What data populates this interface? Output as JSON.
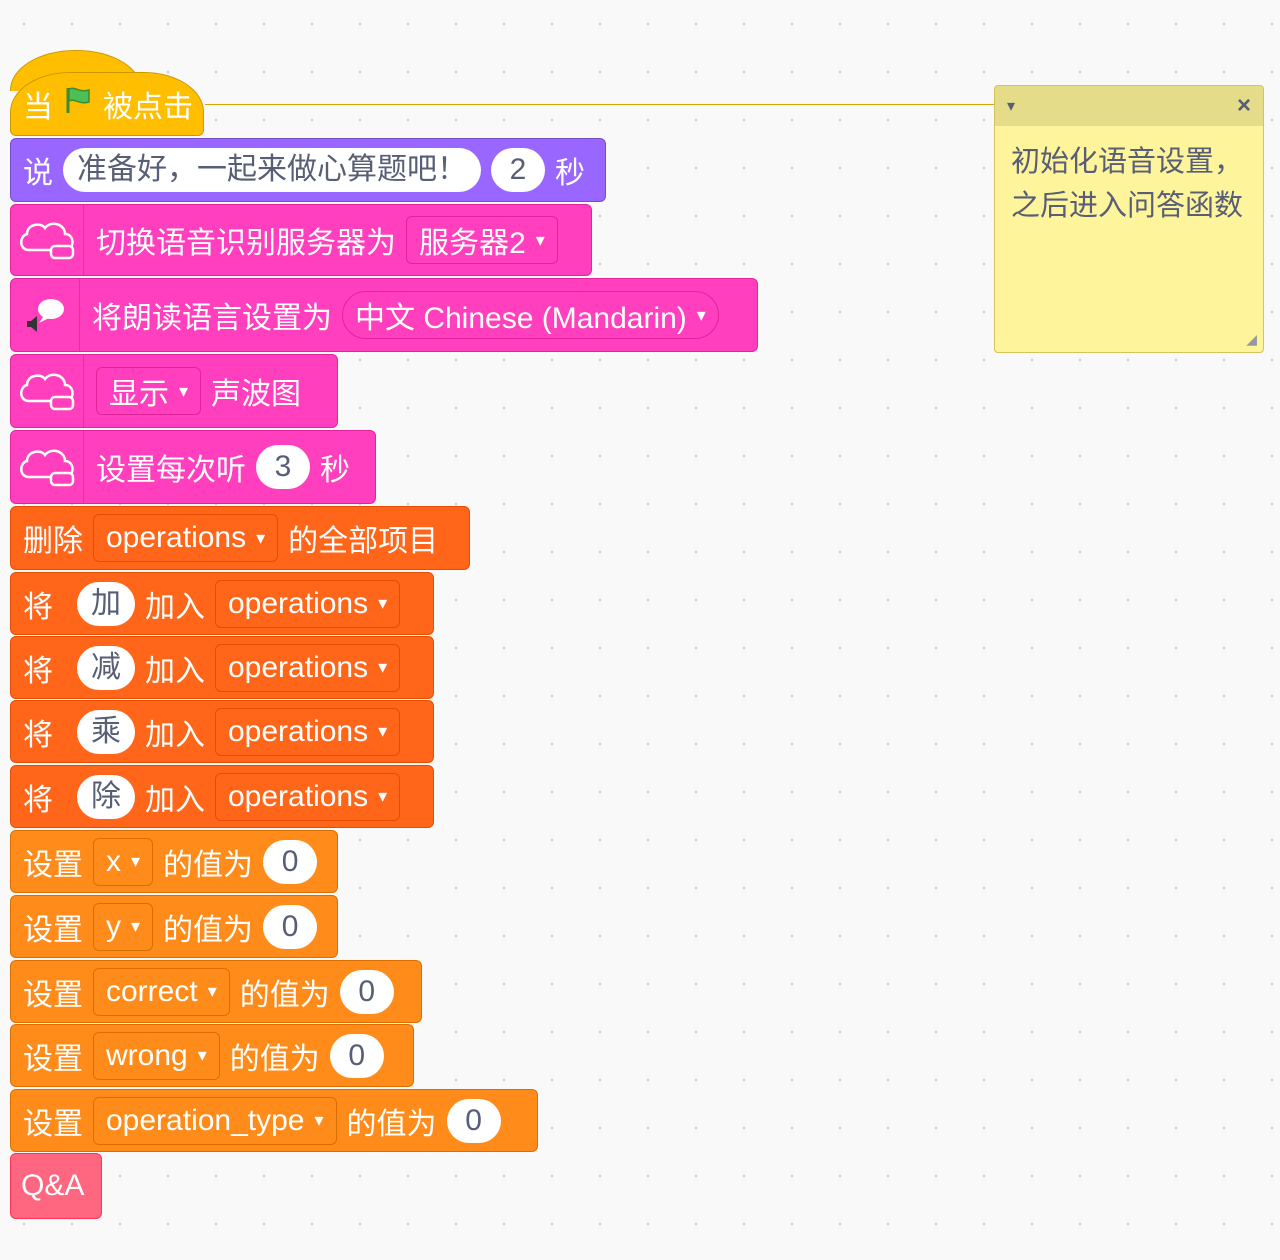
{
  "hat": {
    "when": "当",
    "clicked": "被点击",
    "flag_icon": "green-flag-icon",
    "color": "#ffbf00"
  },
  "say": {
    "label": "说",
    "message": "准备好，一起来做心算题吧！",
    "seconds": "2",
    "unit": "秒",
    "color": "#9966ff"
  },
  "speech_server": {
    "label": "切换语音识别服务器为",
    "server": "服务器2"
  },
  "tts_language": {
    "label": "将朗读语言设置为",
    "language": "中文 Chinese (Mandarin)"
  },
  "show_wave": {
    "mode": "显示",
    "label": "声波图"
  },
  "listen_time": {
    "label": "设置每次听",
    "seconds": "3",
    "unit": "秒"
  },
  "delete_all": {
    "label": "删除",
    "list": "operations",
    "suffix": "的全部项目"
  },
  "add_items": [
    {
      "prefix": "将",
      "item": "加",
      "mid": "加入",
      "list": "operations"
    },
    {
      "prefix": "将",
      "item": "减",
      "mid": "加入",
      "list": "operations"
    },
    {
      "prefix": "将",
      "item": "乘",
      "mid": "加入",
      "list": "operations"
    },
    {
      "prefix": "将",
      "item": "除",
      "mid": "加入",
      "list": "operations"
    }
  ],
  "set_vars": [
    {
      "prefix": "设置",
      "var": "x",
      "suffix": "的值为",
      "value": "0"
    },
    {
      "prefix": "设置",
      "var": "y",
      "suffix": "的值为",
      "value": "0"
    },
    {
      "prefix": "设置",
      "var": "correct",
      "suffix": "的值为",
      "value": "0"
    },
    {
      "prefix": "设置",
      "var": "wrong",
      "suffix": "的值为",
      "value": "0"
    },
    {
      "prefix": "设置",
      "var": "operation_type",
      "suffix": "的值为",
      "value": "0"
    }
  ],
  "custom": {
    "label": "Q&A",
    "color": "#ff6680"
  },
  "note": {
    "text": "初始化语音设置，\n之后进入问答函数",
    "collapse_icon": "caret-down-icon",
    "close_icon": "close-icon"
  },
  "caret": "▾",
  "close": "×"
}
